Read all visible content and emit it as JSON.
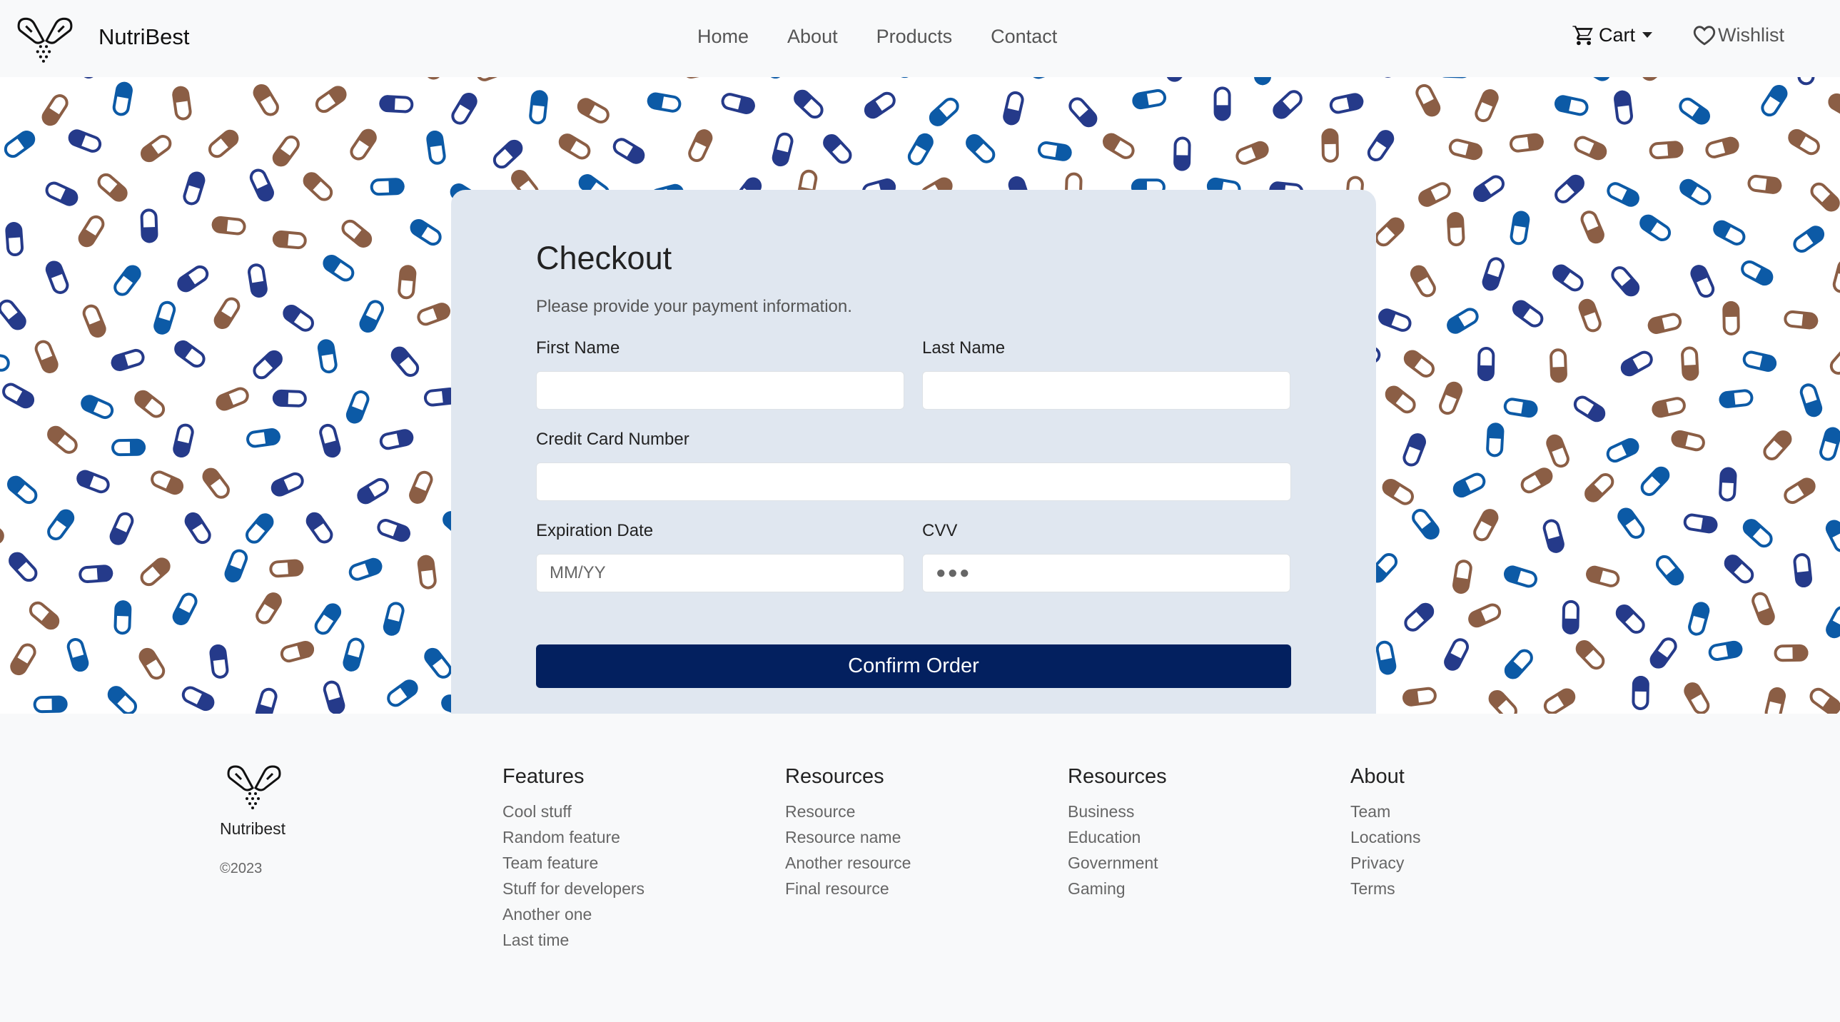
{
  "navbar": {
    "brand": "NutriBest",
    "links": [
      "Home",
      "About",
      "Products",
      "Contact"
    ],
    "cart_label": "Cart",
    "wishlist_label": "Wishlist"
  },
  "checkout": {
    "title": "Checkout",
    "subtitle": "Please provide your payment information.",
    "first_name_label": "First Name",
    "last_name_label": "Last Name",
    "card_number_label": "Credit Card Number",
    "expiration_label": "Expiration Date",
    "expiration_placeholder": "MM/YY",
    "cvv_label": "CVV",
    "cvv_placeholder": "●●●",
    "confirm_label": "Confirm Order"
  },
  "footer": {
    "brand": "Nutribest",
    "copyright": "©2023",
    "columns": [
      {
        "title": "Features",
        "items": [
          "Cool stuff",
          "Random feature",
          "Team feature",
          "Stuff for developers",
          "Another one",
          "Last time"
        ]
      },
      {
        "title": "Resources",
        "items": [
          "Resource",
          "Resource name",
          "Another resource",
          "Final resource"
        ]
      },
      {
        "title": "Resources",
        "items": [
          "Business",
          "Education",
          "Government",
          "Gaming"
        ]
      },
      {
        "title": "About",
        "items": [
          "Team",
          "Locations",
          "Privacy",
          "Terms"
        ]
      }
    ]
  },
  "colors": {
    "primary": "#03205f",
    "card_bg": "#e0e7f0",
    "pill_brown": "#8b5e45",
    "pill_blue": "#0c5aa6",
    "pill_navy": "#253a8a"
  },
  "icons": {
    "brand": "capsule-logo-icon",
    "cart": "cart-icon",
    "wishlist": "heart-icon"
  }
}
